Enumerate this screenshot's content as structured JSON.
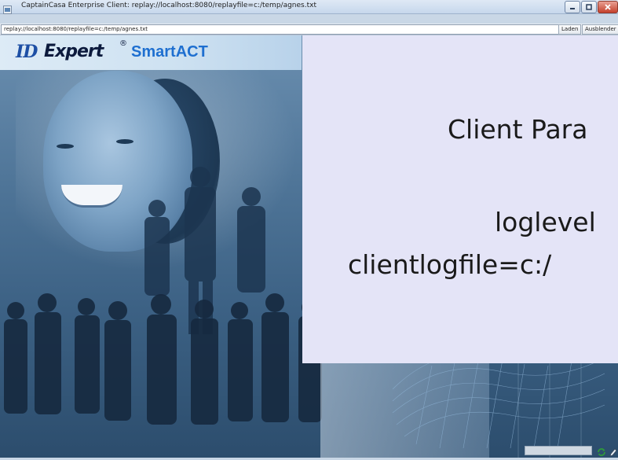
{
  "window": {
    "title": "CaptainCasa Enterprise Client: replay://localhost:8080/replayfile=c:/temp/agnes.txt",
    "controls": [
      "minimize-icon",
      "maximize-icon",
      "close-icon"
    ]
  },
  "address_bar": {
    "value": "replay://localhost:8080/replayfile=c:/temp/agnes.txt",
    "load_label": "Laden",
    "hide_label": "Ausblender"
  },
  "logo": {
    "id": "ID",
    "expert": "Expert",
    "registered": "®",
    "product": "SmartACT"
  },
  "overlay": {
    "line1": "Client Para",
    "line2": "loglevel",
    "line3": "clientlogfile=c:/"
  },
  "status_bar": {
    "icons": [
      "refresh-icon",
      "edit-icon"
    ],
    "colors": {
      "refresh": "#2e9b3a"
    }
  }
}
